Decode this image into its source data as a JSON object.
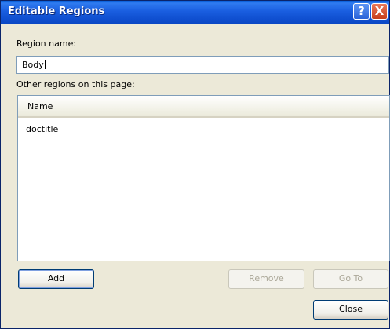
{
  "window": {
    "title": "Editable Regions",
    "help_label": "?",
    "close_label": "X"
  },
  "region_name": {
    "label": "Region name:",
    "value": "Body"
  },
  "other_regions": {
    "label": "Other regions on this page:",
    "column_header": "Name",
    "items": [
      "doctitle"
    ]
  },
  "buttons": {
    "add": "Add",
    "remove": "Remove",
    "goto": "Go To",
    "close": "Close"
  }
}
